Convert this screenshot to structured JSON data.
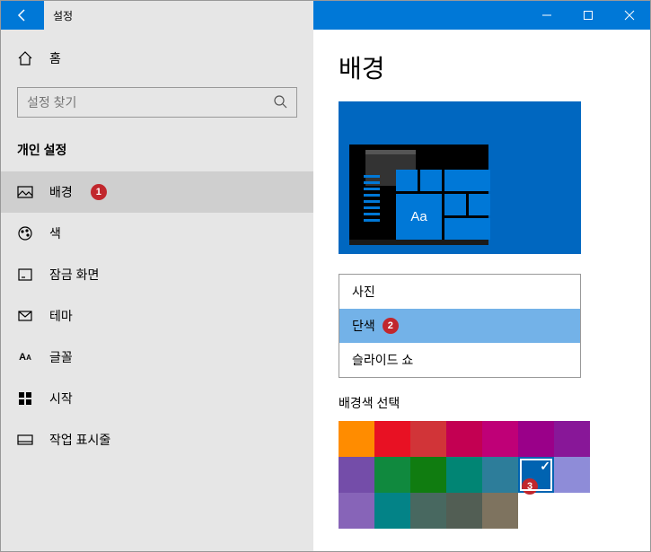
{
  "titlebar": {
    "title": "설정"
  },
  "sidebar": {
    "home": "홈",
    "search_placeholder": "설정 찾기",
    "section": "개인 설정",
    "items": [
      {
        "label": "배경",
        "marker": "1",
        "selected": true
      },
      {
        "label": "색"
      },
      {
        "label": "잠금 화면"
      },
      {
        "label": "테마"
      },
      {
        "label": "글꼴"
      },
      {
        "label": "시작"
      },
      {
        "label": "작업 표시줄"
      }
    ]
  },
  "main": {
    "title": "배경",
    "preview_tile_text": "Aa",
    "dropdown": {
      "options": [
        {
          "label": "사진"
        },
        {
          "label": "단색",
          "marker": "2",
          "selected": true
        },
        {
          "label": "슬라이드 쇼"
        }
      ]
    },
    "color_section_label": "배경색 선택",
    "colors": [
      {
        "hex": "#ff8c00"
      },
      {
        "hex": "#e81123"
      },
      {
        "hex": "#d13438"
      },
      {
        "hex": "#c30052"
      },
      {
        "hex": "#bf0077"
      },
      {
        "hex": "#9a0089"
      },
      {
        "hex": "#881798"
      },
      {
        "hex": "#744da9"
      },
      {
        "hex": "#10893e"
      },
      {
        "hex": "#107c10"
      },
      {
        "hex": "#018574"
      },
      {
        "hex": "#2d7d9a"
      },
      {
        "hex": "#0063b1",
        "selected": true,
        "marker": "3"
      },
      {
        "hex": "#8e8cd8"
      },
      {
        "hex": "#8764b8"
      },
      {
        "hex": "#038387"
      },
      {
        "hex": "#486860"
      },
      {
        "hex": "#525e54"
      },
      {
        "hex": "#7e735f"
      }
    ]
  }
}
